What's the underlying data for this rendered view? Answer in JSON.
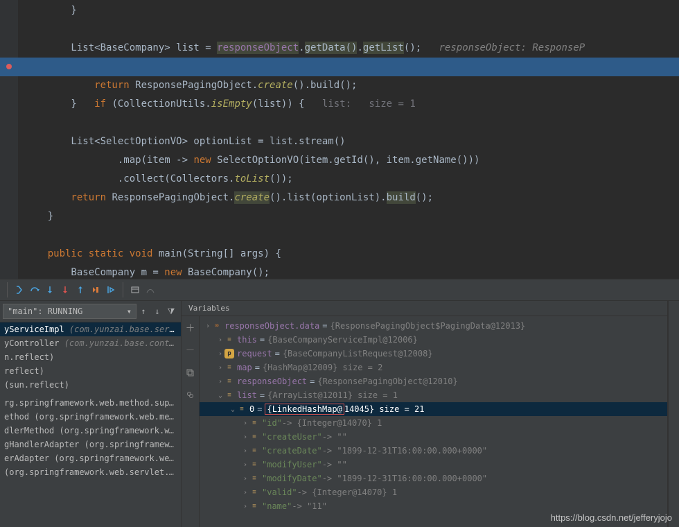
{
  "editor": {
    "l1": "        }",
    "l2": "",
    "l3a": "        List<BaseCompany> list = ",
    "l3b": "responseObject",
    "l3c": ".",
    "l3d": "getData()",
    "l3e": ".",
    "l3f": "getList",
    "l3g": "();   ",
    "l3h": "responseObject: ResponseP",
    "l4a": "        if",
    "l4b": " (CollectionUtils.",
    "l4c": "isEmpty",
    "l4d": "(list)) {   ",
    "l4e": "list:   size = 1",
    "l5a": "            return",
    "l5b": " ResponsePagingObject.",
    "l5c": "create",
    "l5d": "().build();",
    "l6": "        }",
    "l7": "",
    "l8": "        List<SelectOptionVO> optionList = list.stream()",
    "l9a": "                .map(item -> ",
    "l9b": "new",
    "l9c": " SelectOptionVO(item.getId(), item.getName()))",
    "l10a": "                .collect(Collectors.",
    "l10b": "toList",
    "l10c": "());",
    "l11a": "        return",
    "l11b": " ResponsePagingObject.",
    "l11c": "create",
    "l11d": "().list(optionList).",
    "l11e": "build",
    "l11f": "();",
    "l12": "    }",
    "l13": "",
    "l14a": "    public static void",
    "l14b": " main",
    "l14c": "(String[] args) {",
    "l15a": "        BaseCompany m = ",
    "l15b": "new",
    "l15c": " BaseCompany();"
  },
  "frames": {
    "thread": "\"main\": RUNNING",
    "items": [
      {
        "svc": "yServiceImpl",
        "pkg": " (com.yunzai.base.service.impl)"
      },
      {
        "svc": "yController",
        "pkg": " (com.yunzai.base.controller)"
      },
      {
        "svc": "n.reflect)",
        "pkg": ""
      },
      {
        "svc": "reflect)",
        "pkg": ""
      },
      {
        "svc": "(sun.reflect)",
        "pkg": ""
      },
      {
        "svc": "",
        "pkg": ""
      },
      {
        "svc": "rg.springframework.web.method.support)",
        "pkg": ""
      },
      {
        "svc": "ethod (org.springframework.web.method.su",
        "pkg": ""
      },
      {
        "svc": "dlerMethod (org.springframework.web.serv",
        "pkg": ""
      },
      {
        "svc": "gHandlerAdapter (org.springframework.we",
        "pkg": ""
      },
      {
        "svc": "erAdapter (org.springframework.web.servle",
        "pkg": ""
      },
      {
        "svc": "(org.springframework.web.servlet.mvc.meth",
        "pkg": ""
      }
    ]
  },
  "vars": {
    "title": "Variables",
    "rows": [
      {
        "d": 0,
        "a": ">",
        "i": "oo",
        "n": "responseObject.data",
        "eq": " = ",
        "v": "{ResponsePagingObject$PagingData@12013}",
        "vcls": "vgrey"
      },
      {
        "d": 1,
        "a": ">",
        "i": "f",
        "n": "this",
        "eq": " = ",
        "v": "{BaseCompanyServiceImpl@12006}",
        "vcls": "vgrey"
      },
      {
        "d": 1,
        "a": ">",
        "i": "p",
        "n": "request",
        "eq": " = ",
        "v": "{BaseCompanyListRequest@12008}",
        "vcls": "vgrey"
      },
      {
        "d": 1,
        "a": ">",
        "i": "f",
        "n": "map",
        "eq": " = ",
        "v": "{HashMap@12009}  size = 2",
        "vcls": "vgrey"
      },
      {
        "d": 1,
        "a": ">",
        "i": "f",
        "n": "responseObject",
        "eq": " = ",
        "v": "{ResponsePagingObject@12010}",
        "vcls": "vgrey"
      },
      {
        "d": 1,
        "a": "v",
        "i": "f",
        "n": "list",
        "eq": " = ",
        "v": "{ArrayList@12011}  size = 1",
        "vcls": "vgrey"
      },
      {
        "d": 2,
        "a": "v",
        "i": "f",
        "n": "0",
        "eq": " = ",
        "red": "{LinkedHashMap@",
        "v2": "14045}  size = 21",
        "vcls": "",
        "sel": true
      },
      {
        "d": 3,
        "a": ">",
        "i": "f",
        "n": "",
        "eq": "",
        "vstr": "\"id\" -> {Integer@14070} 1"
      },
      {
        "d": 3,
        "a": ">",
        "i": "f",
        "n": "",
        "eq": "",
        "vstr": "\"createUser\" -> \"\""
      },
      {
        "d": 3,
        "a": ">",
        "i": "f",
        "n": "",
        "eq": "",
        "vstr": "\"createDate\" -> \"1899-12-31T16:00:00.000+0000\""
      },
      {
        "d": 3,
        "a": ">",
        "i": "f",
        "n": "",
        "eq": "",
        "vstr": "\"modifyUser\" -> \"\""
      },
      {
        "d": 3,
        "a": ">",
        "i": "f",
        "n": "",
        "eq": "",
        "vstr": "\"modifyDate\" -> \"1899-12-31T16:00:00.000+0000\""
      },
      {
        "d": 3,
        "a": ">",
        "i": "f",
        "n": "",
        "eq": "",
        "vstr": "\"valid\" -> {Integer@14070} 1"
      },
      {
        "d": 3,
        "a": ">",
        "i": "f",
        "n": "",
        "eq": "",
        "vstr": "\"name\" -> \"11\""
      }
    ]
  },
  "watermark": "https://blog.csdn.net/jefferyjojo"
}
